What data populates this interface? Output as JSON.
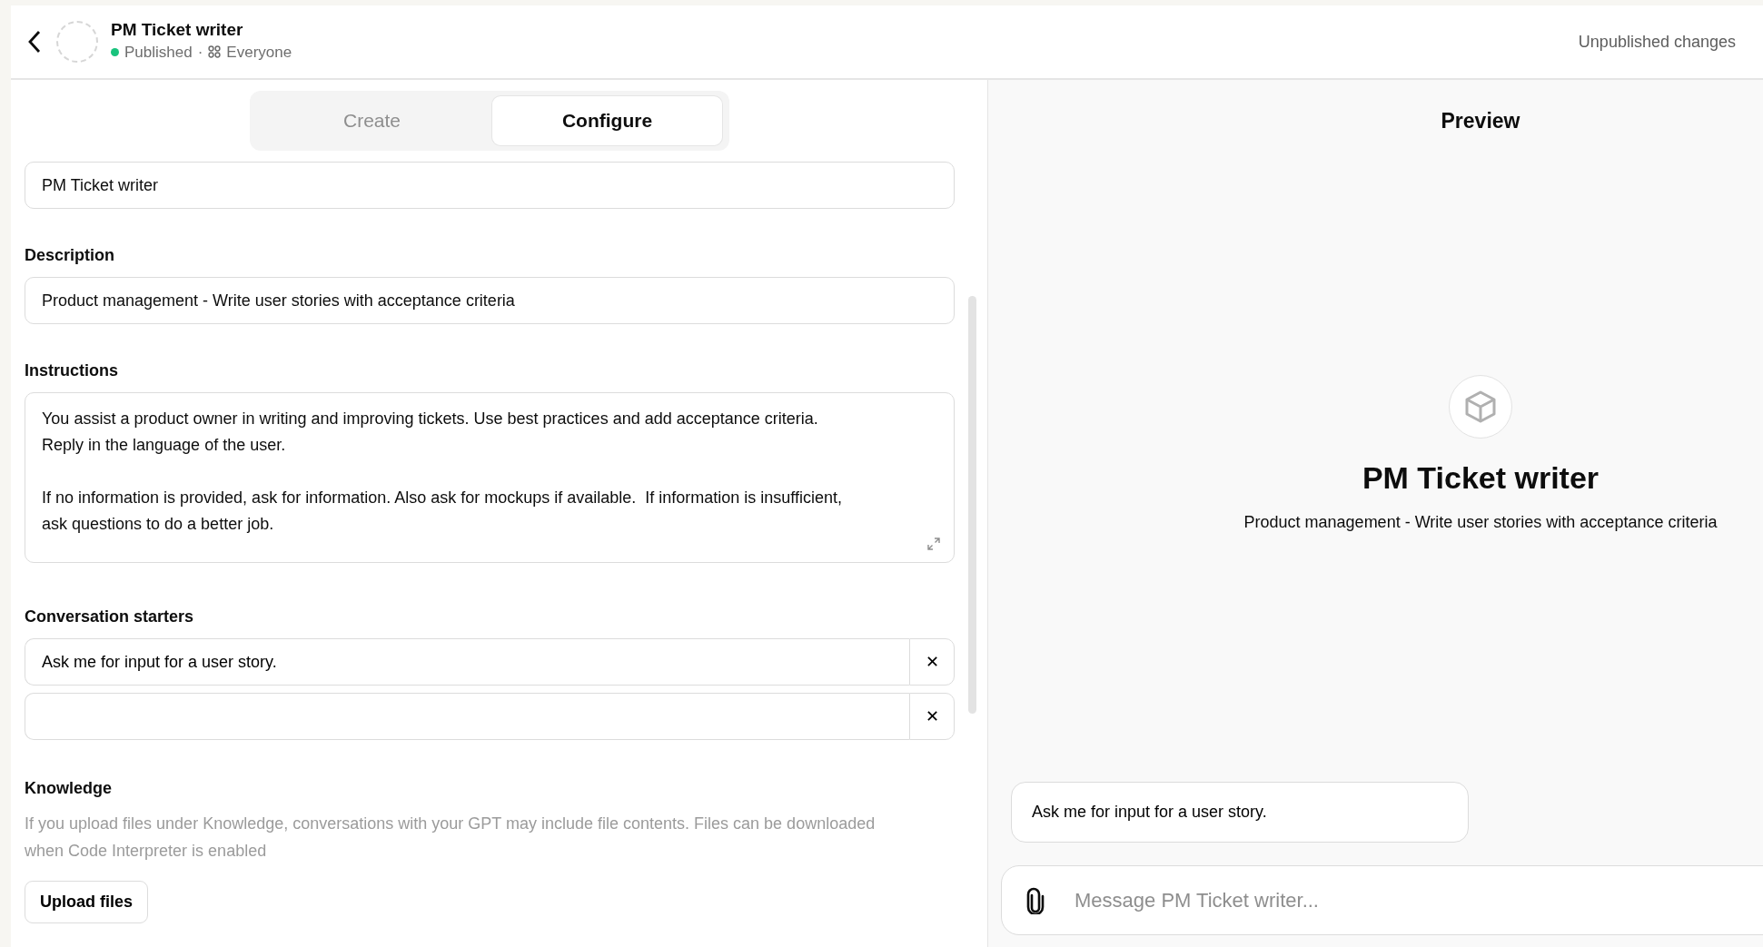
{
  "header": {
    "title": "PM Ticket writer",
    "status": "Published",
    "separator": "·",
    "visibility": "Everyone",
    "notice": "Unpublished changes"
  },
  "tabs": [
    {
      "label": "Create",
      "selected": false
    },
    {
      "label": "Configure",
      "selected": true
    }
  ],
  "name_field": {
    "value": "PM Ticket writer"
  },
  "description": {
    "label": "Description",
    "value": "Product management - Write user stories with acceptance criteria"
  },
  "instructions": {
    "label": "Instructions",
    "value": "You assist a product owner in writing and improving tickets. Use best practices and add acceptance criteria. Reply in the language of the user.\n\nIf no information is provided, ask for information. Also ask for mockups if available.  If information is insufficient, ask questions to do a better job."
  },
  "conversation_starters": {
    "label": "Conversation starters",
    "remove_glyph": "✕",
    "items": [
      {
        "value": "Ask me for input for a user story."
      },
      {
        "value": null
      }
    ]
  },
  "knowledge": {
    "label": "Knowledge",
    "help": "If you upload files under Knowledge, conversations with your GPT may include file contents. Files can be downloaded when Code Interpreter is enabled",
    "button": "Upload files"
  },
  "preview": {
    "heading": "Preview",
    "title": "PM Ticket writer",
    "description": "Product management - Write user stories with acceptance criteria",
    "starters": [
      "Ask me for input for a user story."
    ],
    "composer": {
      "placeholder": "Message PM Ticket writer..."
    }
  }
}
